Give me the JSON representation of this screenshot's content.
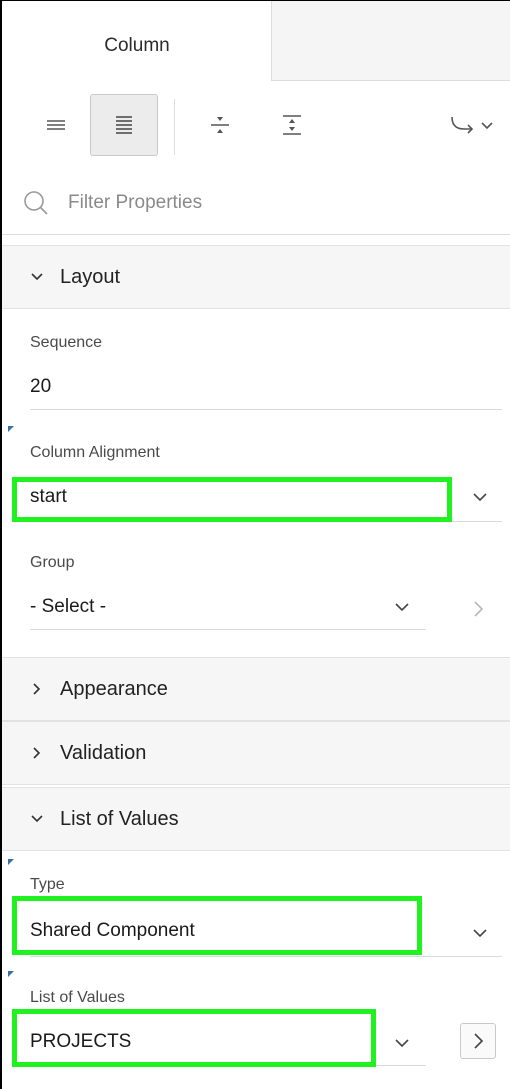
{
  "tab": {
    "label": "Column"
  },
  "toolbar": {
    "buttons": [
      {
        "icon": "rows-collapsed-icon"
      },
      {
        "icon": "rows-expanded-icon"
      },
      {
        "icon": "collapse-all-icon"
      },
      {
        "icon": "expand-all-icon"
      },
      {
        "icon": "go-to-menu-icon"
      }
    ]
  },
  "filter": {
    "placeholder": "Filter Properties"
  },
  "sections": {
    "layout": {
      "title": "Layout",
      "sequence": {
        "label": "Sequence",
        "value": "20"
      },
      "column_alignment": {
        "label": "Column Alignment",
        "value": "start"
      },
      "group": {
        "label": "Group",
        "value": "- Select -"
      }
    },
    "appearance": {
      "title": "Appearance"
    },
    "validation": {
      "title": "Validation"
    },
    "list_of_values": {
      "title": "List of Values",
      "type": {
        "label": "Type",
        "value": "Shared Component"
      },
      "lov": {
        "label": "List of Values",
        "value": "PROJECTS"
      }
    }
  },
  "colors": {
    "highlight": "#1ff21f",
    "active_button_bg": "#ececec",
    "section_bg": "#f6f6f6",
    "change_marker": "#3b6ea5"
  }
}
